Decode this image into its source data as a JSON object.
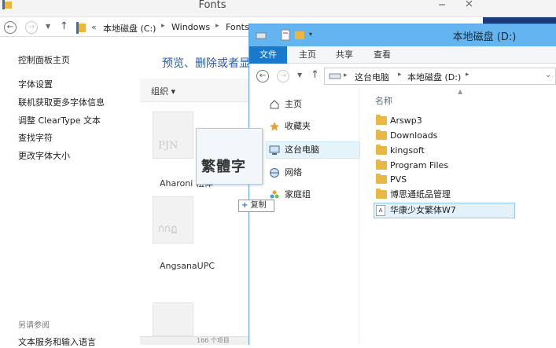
{
  "fonts_window": {
    "title": "Fonts",
    "address": {
      "prefix": "«",
      "crumbs": [
        "本地磁盘 (C:)",
        "Windows",
        "Fonts"
      ]
    },
    "sidebar": {
      "links": [
        "控制面板主页",
        "字体设置",
        "联机获取更多字体信息",
        "调整 ClearType 文本",
        "查找字符",
        "更改字体大小"
      ],
      "see_also_label": "另请参阅",
      "see_also_links": [
        "文本服务和输入语言"
      ]
    },
    "header": "预览、删除或者显示和隐藏计算机上安装的字体",
    "toolbar": {
      "organize": "组织 ▾"
    },
    "tiles": [
      {
        "preview": "PJN",
        "name": "Aharoni 粗体"
      },
      {
        "preview": "กกฏ",
        "name": "AngsanaUPC"
      }
    ],
    "status": "166 个项目"
  },
  "drag": {
    "preview_text": "繁體字",
    "copy_tip": {
      "plus": "+",
      "label": "复制"
    }
  },
  "d_window": {
    "title": "本地磁盘 (D:)",
    "ribbon_tabs": [
      "文件",
      "主页",
      "共享",
      "查看"
    ],
    "address": {
      "crumbs": [
        "这台电脑",
        "本地磁盘 (D:)"
      ]
    },
    "nav": [
      {
        "label": "主页",
        "icon": "home-icon"
      },
      {
        "label": "收藏夹",
        "icon": "star-icon"
      },
      {
        "label": "这台电脑",
        "icon": "computer-icon"
      },
      {
        "label": "网络",
        "icon": "network-icon"
      },
      {
        "label": "家庭组",
        "icon": "homegroup-icon"
      }
    ],
    "column_header": "名称",
    "files": [
      {
        "name": "Arswp3",
        "type": "folder"
      },
      {
        "name": "Downloads",
        "type": "folder"
      },
      {
        "name": "kingsoft",
        "type": "folder"
      },
      {
        "name": "Program Files",
        "type": "folder"
      },
      {
        "name": "PVS",
        "type": "folder"
      },
      {
        "name": "博思通纸品管理",
        "type": "folder"
      },
      {
        "name": "华康少女繁体W7",
        "type": "font"
      }
    ]
  },
  "colors": {
    "title_blue": "#64b4ef",
    "file_tab": "#1979ca",
    "folder": "#e8b745",
    "link_blue": "#2a5aa8"
  }
}
